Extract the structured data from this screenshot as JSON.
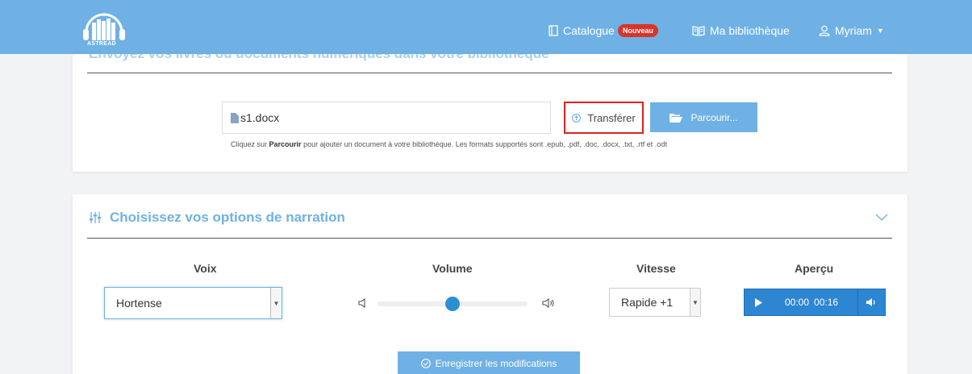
{
  "header": {
    "brand": "ASTREAD",
    "catalogue_label": "Catalogue",
    "catalogue_badge": "Nouveau",
    "library_label": "Ma bibliothèque",
    "user_name": "Myriam"
  },
  "upload": {
    "section_title": "Envoyez vos livres ou documents numériques dans votre bibliothèque",
    "file_value": "s1.docx",
    "transfer_label": "Transférer",
    "browse_label": "Parcourir...",
    "help_prefix": "Cliquez sur ",
    "help_bold": "Parcourir",
    "help_suffix": " pour ajouter un document à votre bibliothèque. Les formats supportés sont .epub, .pdf, .doc, .docx, .txt, .rtf et .odt"
  },
  "narration": {
    "section_title": "Choisissez vos options de narration",
    "voice_label": "Voix",
    "voice_value": "Hortense",
    "volume_label": "Volume",
    "volume_level": 0.5,
    "speed_label": "Vitesse",
    "speed_value": "Rapide +1",
    "preview_label": "Aperçu",
    "current_time": "00:00",
    "duration": "00:16",
    "save_label": "Enregistrer les modifications"
  },
  "colors": {
    "brand": "#6fb1e4",
    "player": "#2d86d2",
    "badge": "#d9342b",
    "highlight": "#e0201d"
  }
}
